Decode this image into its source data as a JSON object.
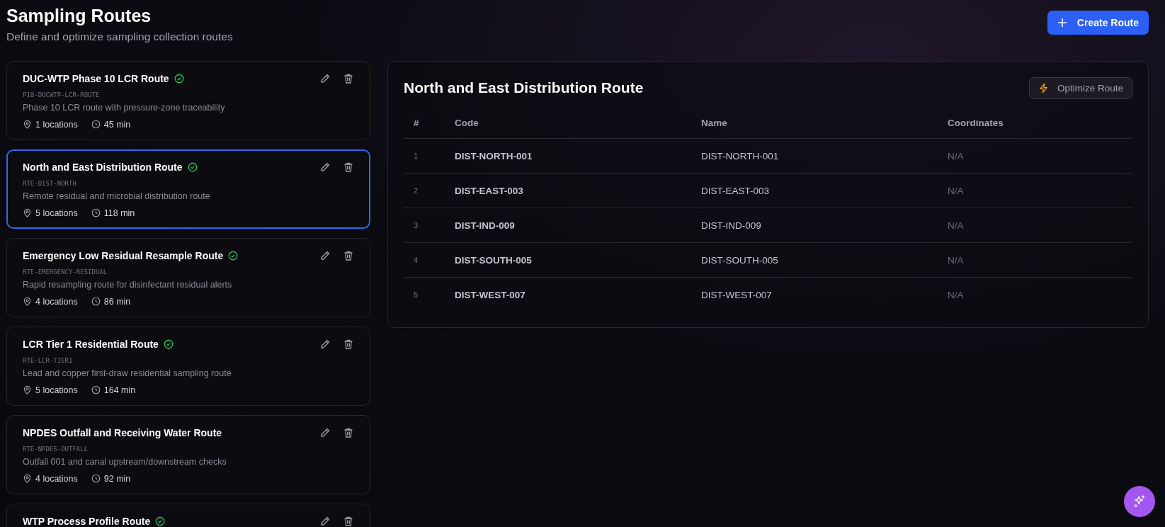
{
  "header": {
    "title": "Sampling Routes",
    "subtitle": "Define and optimize sampling collection routes",
    "create_button": "Create Route"
  },
  "routes": [
    {
      "name": "DUC-WTP Phase 10 LCR Route",
      "verified": true,
      "selected": false,
      "code": "P10-DUCWTP-LCR-ROUTE",
      "description": "Phase 10 LCR route with pressure-zone traceability",
      "locations": "1 locations",
      "duration": "45 min"
    },
    {
      "name": "North and East Distribution Route",
      "verified": true,
      "selected": true,
      "code": "RTE-DIST-NORTH",
      "description": "Remote residual and microbial distribution route",
      "locations": "5 locations",
      "duration": "118 min"
    },
    {
      "name": "Emergency Low Residual Resample Route",
      "verified": true,
      "selected": false,
      "code": "RTE-EMERGENCY-RESIDUAL",
      "description": "Rapid resampling route for disinfectant residual alerts",
      "locations": "4 locations",
      "duration": "86 min"
    },
    {
      "name": "LCR Tier 1 Residential Route",
      "verified": true,
      "selected": false,
      "code": "RTE-LCR-TIER1",
      "description": "Lead and copper first-draw residential sampling route",
      "locations": "5 locations",
      "duration": "164 min"
    },
    {
      "name": "NPDES Outfall and Receiving Water Route",
      "verified": false,
      "selected": false,
      "code": "RTE-NPDES-OUTFALL",
      "description": "Outfall 001 and canal upstream/downstream checks",
      "locations": "4 locations",
      "duration": "92 min"
    },
    {
      "name": "WTP Process Profile Route",
      "verified": true,
      "selected": false
    }
  ],
  "detail": {
    "title": "North and East Distribution Route",
    "optimize_button": "Optimize Route",
    "table": {
      "columns": [
        "#",
        "Code",
        "Name",
        "Coordinates"
      ],
      "rows": [
        [
          "1",
          "DIST-NORTH-001",
          "DIST-NORTH-001",
          "N/A"
        ],
        [
          "2",
          "DIST-EAST-003",
          "DIST-EAST-003",
          "N/A"
        ],
        [
          "3",
          "DIST-IND-009",
          "DIST-IND-009",
          "N/A"
        ],
        [
          "4",
          "DIST-SOUTH-005",
          "DIST-SOUTH-005",
          "N/A"
        ],
        [
          "5",
          "DIST-WEST-007",
          "DIST-WEST-007",
          "N/A"
        ]
      ]
    }
  }
}
